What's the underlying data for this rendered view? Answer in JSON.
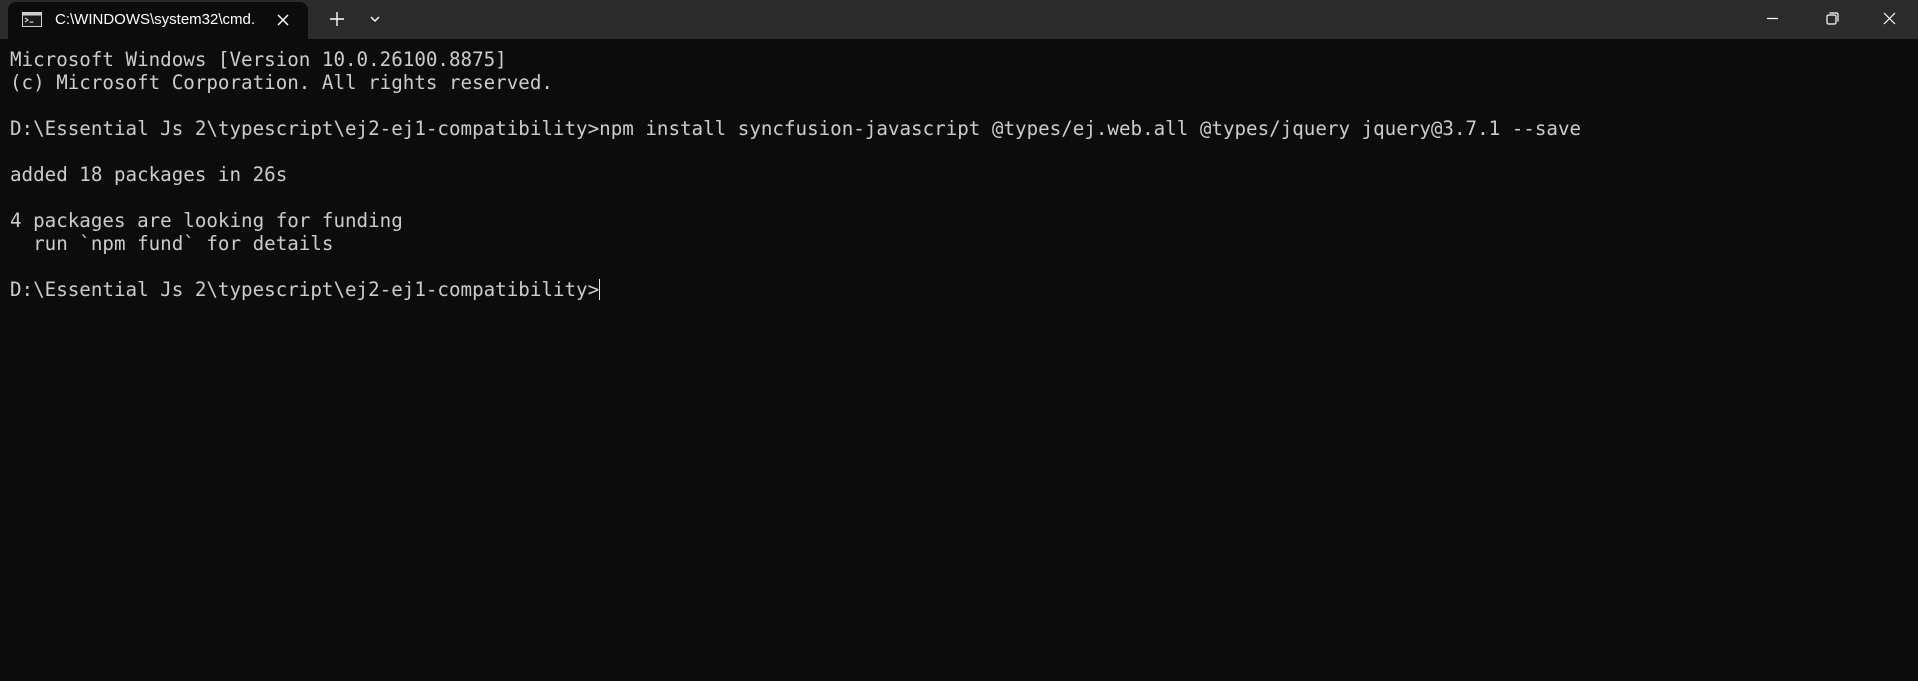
{
  "window": {
    "tab_title": "C:\\WINDOWS\\system32\\cmd.",
    "tab_icon": "terminal-icon",
    "new_tab_icon": "plus-icon",
    "dropdown_icon": "chevron-down-icon",
    "minimize_icon": "minimize-icon",
    "restore_icon": "restore-icon",
    "close_icon": "close-icon"
  },
  "colors": {
    "background": "#0c0c0c",
    "titlebar": "#2b2b2b",
    "text": "#cccccc"
  },
  "terminal": {
    "lines": [
      "Microsoft Windows [Version 10.0.26100.8875]",
      "(c) Microsoft Corporation. All rights reserved.",
      "",
      "D:\\Essential Js 2\\typescript\\ej2-ej1-compatibility>npm install syncfusion-javascript @types/ej.web.all @types/jquery jquery@3.7.1 --save",
      "",
      "added 18 packages in 26s",
      "",
      "4 packages are looking for funding",
      "  run `npm fund` for details",
      ""
    ],
    "prompt": "D:\\Essential Js 2\\typescript\\ej2-ej1-compatibility>"
  }
}
